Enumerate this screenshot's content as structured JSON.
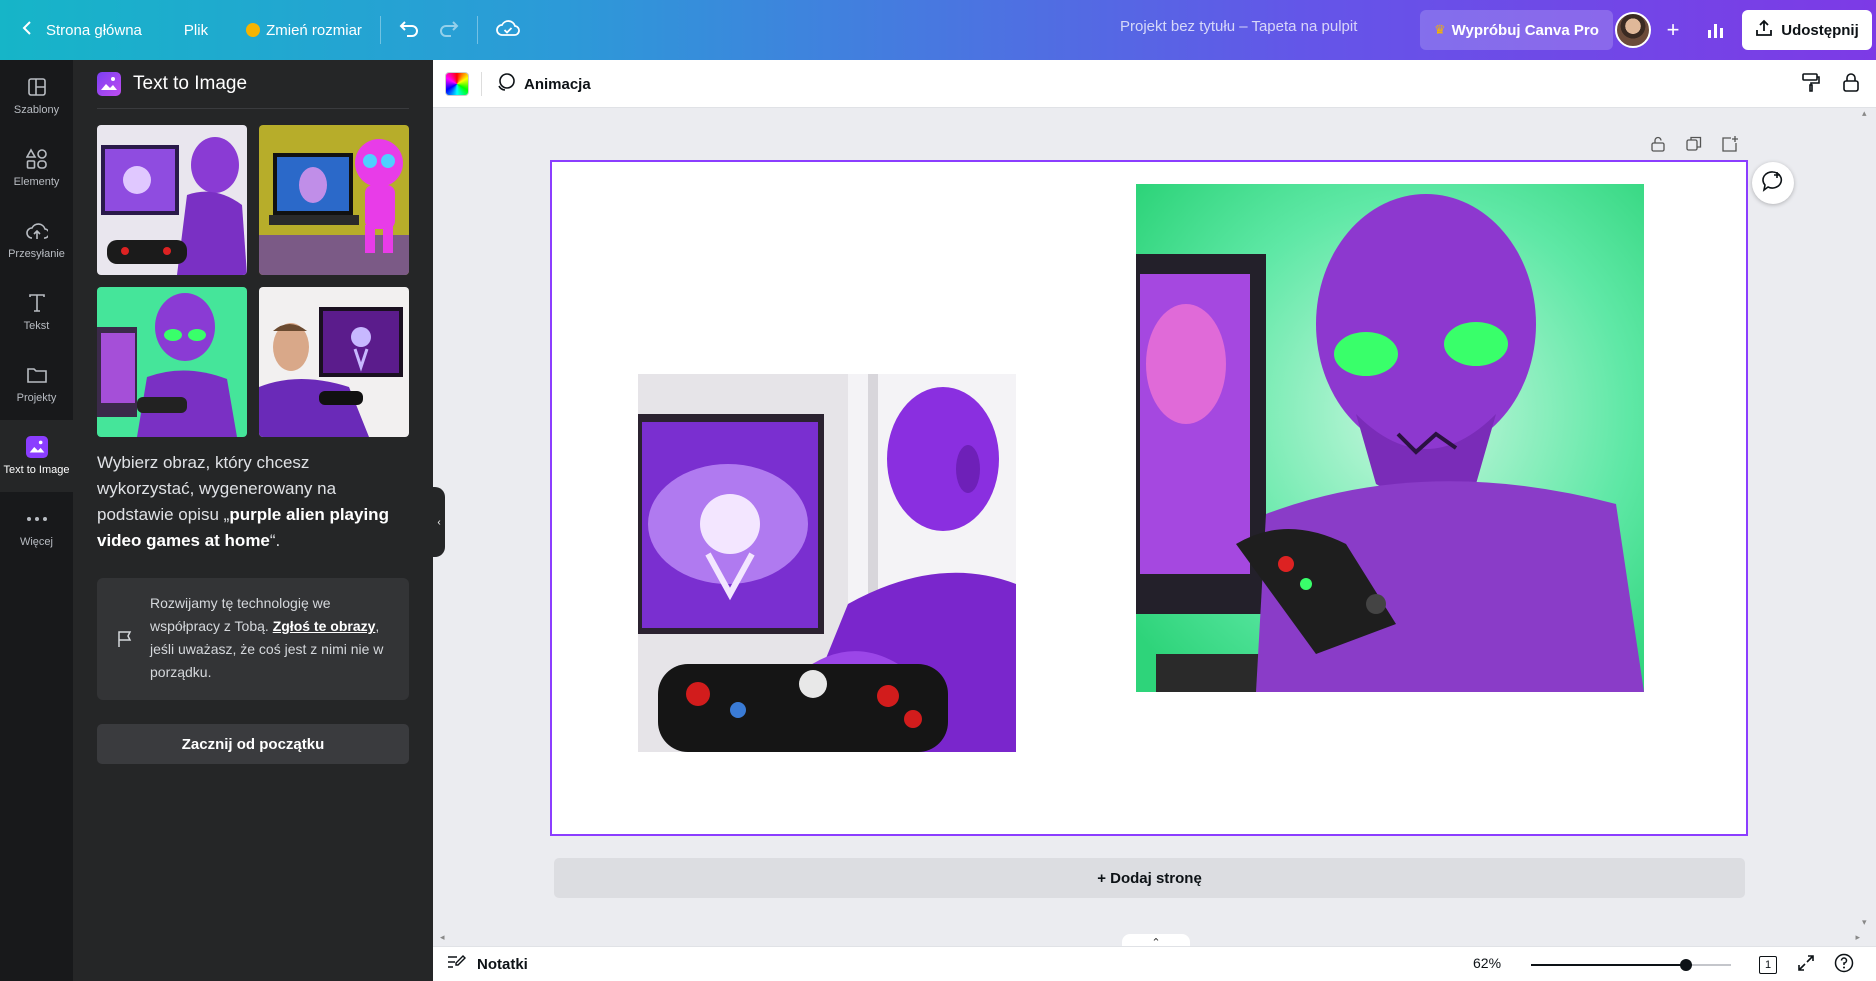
{
  "topbar": {
    "back_label": "Strona główna",
    "file_label": "Plik",
    "resize_label": "Zmień rozmiar",
    "doc_title": "Projekt bez tytułu – Tapeta na pulpit",
    "pro_label": "Wypróbuj Canva Pro",
    "share_label": "Udostępnij"
  },
  "rail": {
    "items": [
      {
        "label": "Szablony",
        "icon": "templates-icon"
      },
      {
        "label": "Elementy",
        "icon": "elements-icon"
      },
      {
        "label": "Przesyłanie",
        "icon": "upload-icon"
      },
      {
        "label": "Tekst",
        "icon": "text-icon"
      },
      {
        "label": "Projekty",
        "icon": "folder-icon"
      },
      {
        "label": "Text to Image",
        "icon": "text-to-image-icon"
      },
      {
        "label": "Więcej",
        "icon": "more-icon"
      }
    ],
    "active_index": 5
  },
  "panel": {
    "title": "Text to Image",
    "description_prefix": "Wybierz obraz, który chcesz wykorzystać, wygenerowany na podstawie opisu „",
    "prompt": "purple alien playing video games at home",
    "description_suffix": "“.",
    "note_prefix": "Rozwijamy tę technologię we współpracy z Tobą. ",
    "note_link": "Zgłoś te obrazy",
    "note_suffix": ", jeśli uważasz, że coś jest z nimi nie w porządku.",
    "restart_label": "Zacznij od początku"
  },
  "canvas_toolbar": {
    "animation_label": "Animacja"
  },
  "canvas": {
    "add_page_label": "+ Dodaj stronę"
  },
  "bottombar": {
    "notes_label": "Notatki",
    "zoom_label": "62%",
    "zoom_fraction": 0.62,
    "page_count": "1"
  },
  "colors": {
    "accent": "#8b3dff",
    "rail_bg": "#18191b",
    "panel_bg": "#252627"
  }
}
